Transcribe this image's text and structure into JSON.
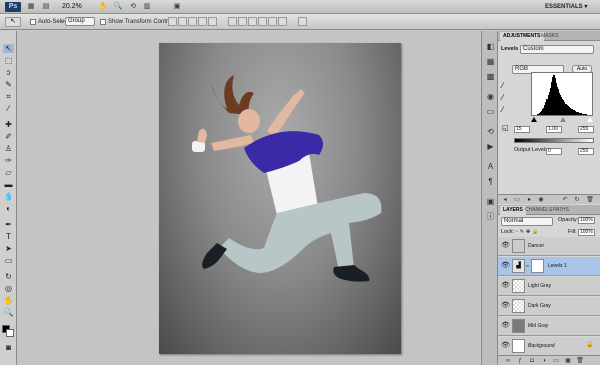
{
  "appbar": {
    "logo": "Ps",
    "zoom": "20.2%",
    "workspace": "ESSENTIALS ▾"
  },
  "options": {
    "auto_select_label": "Auto-Select:",
    "auto_select_value": "Group",
    "show_transform_label": "Show Transform Controls"
  },
  "adjustments": {
    "tabs": [
      "ADJUSTMENTS",
      "MASKS"
    ],
    "title": "Levels",
    "preset": "Custom",
    "channel": "RGB",
    "auto_label": "Auto",
    "input_black": "15",
    "input_gamma": "1.00",
    "input_white": "255",
    "output_label": "Output Levels:",
    "output_black": "0",
    "output_white": "255",
    "histogram": [
      2,
      3,
      3,
      4,
      5,
      6,
      8,
      10,
      12,
      15,
      18,
      22,
      28,
      36,
      44,
      52,
      60,
      70,
      84,
      96,
      100,
      92,
      80,
      72,
      66,
      58,
      52,
      48,
      44,
      40,
      36,
      32,
      30,
      28,
      26,
      24,
      22,
      20,
      18,
      17,
      16,
      14,
      13,
      12,
      11,
      10,
      9,
      8,
      8,
      7,
      6,
      6,
      5,
      5,
      4,
      4,
      3,
      3,
      2,
      2
    ]
  },
  "layers": {
    "tabs": [
      "LAYERS",
      "CHANNELS",
      "PATHS"
    ],
    "blend_mode": "Normal",
    "opacity_label": "Opacity:",
    "opacity": "100%",
    "lock_label": "Lock:",
    "fill_label": "Fill:",
    "fill": "100%",
    "items": [
      {
        "name": "Dancer"
      },
      {
        "name": "Levels 1"
      },
      {
        "name": "Light Gray"
      },
      {
        "name": "Dark Gray"
      },
      {
        "name": "Mid Gray"
      },
      {
        "name": "Background"
      }
    ]
  }
}
